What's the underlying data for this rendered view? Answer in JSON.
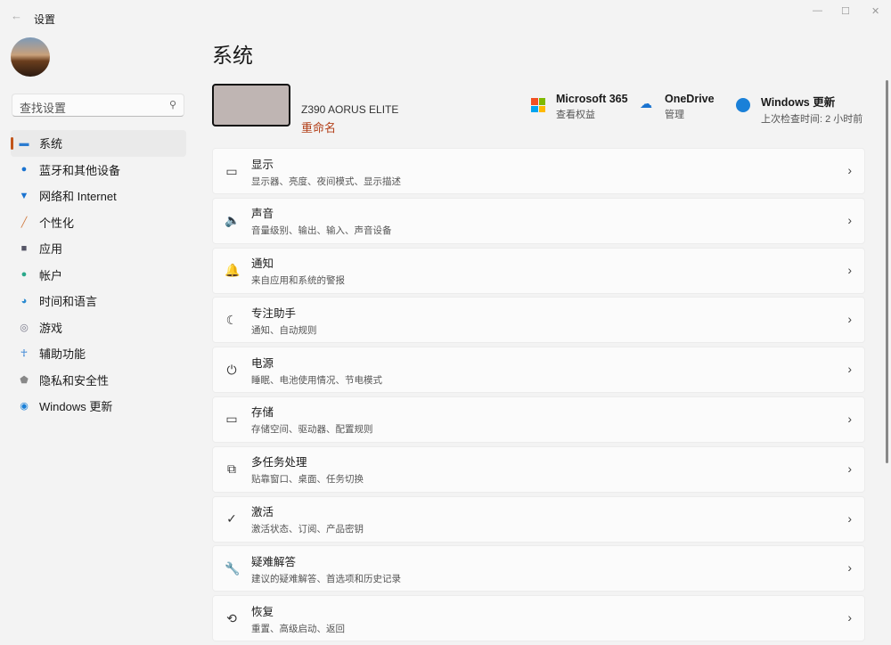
{
  "window": {
    "title": "设置",
    "back": "←"
  },
  "search": {
    "placeholder": "查找设置"
  },
  "nav": [
    {
      "label": "系统",
      "icon": "monitor-icon",
      "color": "#2a7bd0",
      "glyph": "▬"
    },
    {
      "label": "蓝牙和其他设备",
      "icon": "bluetooth-icon",
      "color": "#1a73d0",
      "glyph": "●"
    },
    {
      "label": "网络和 Internet",
      "icon": "wifi-icon",
      "color": "#1a73d0",
      "glyph": "▼"
    },
    {
      "label": "个性化",
      "icon": "brush-icon",
      "color": "#d07a40",
      "glyph": "╱"
    },
    {
      "label": "应用",
      "icon": "apps-icon",
      "color": "#556",
      "glyph": "■"
    },
    {
      "label": "帐户",
      "icon": "account-icon",
      "color": "#2aa88a",
      "glyph": "●"
    },
    {
      "label": "时间和语言",
      "icon": "globe-clock-icon",
      "color": "#2a8ad0",
      "glyph": "◕"
    },
    {
      "label": "游戏",
      "icon": "gamepad-icon",
      "color": "#778",
      "glyph": "◎"
    },
    {
      "label": "辅助功能",
      "icon": "accessibility-icon",
      "color": "#1a73d0",
      "glyph": "☥"
    },
    {
      "label": "隐私和安全性",
      "icon": "shield-icon",
      "color": "#888",
      "glyph": "⬟"
    },
    {
      "label": "Windows 更新",
      "icon": "update-icon",
      "color": "#1a80d8",
      "glyph": "◉"
    }
  ],
  "main": {
    "title": "系统",
    "device_name": "Z390 AORUS ELITE",
    "rename": "重命名",
    "services": [
      {
        "title": "Microsoft 365",
        "sub": "查看权益"
      },
      {
        "title": "OneDrive",
        "sub": "管理"
      },
      {
        "title": "Windows 更新",
        "sub": "上次检查时间: 2 小时前"
      }
    ],
    "items": [
      {
        "title": "显示",
        "sub": "显示器、亮度、夜间模式、显示描述",
        "icon": "display-icon",
        "glyph": "▭"
      },
      {
        "title": "声音",
        "sub": "音量级别、输出、输入、声音设备",
        "icon": "speaker-icon",
        "glyph": "🔈"
      },
      {
        "title": "通知",
        "sub": "来自应用和系统的警报",
        "icon": "bell-icon",
        "glyph": "🔔"
      },
      {
        "title": "专注助手",
        "sub": "通知、自动规则",
        "icon": "moon-icon",
        "glyph": "☾"
      },
      {
        "title": "电源",
        "sub": "睡眠、电池使用情况、节电模式",
        "icon": "power-icon",
        "glyph": "⏻"
      },
      {
        "title": "存储",
        "sub": "存储空间、驱动器、配置规则",
        "icon": "storage-icon",
        "glyph": "▭"
      },
      {
        "title": "多任务处理",
        "sub": "贴靠窗口、桌面、任务切换",
        "icon": "multitask-icon",
        "glyph": "⧉"
      },
      {
        "title": "激活",
        "sub": "激活状态、订阅、产品密钥",
        "icon": "check-circle-icon",
        "glyph": "✓"
      },
      {
        "title": "疑难解答",
        "sub": "建议的疑难解答、首选项和历史记录",
        "icon": "wrench-icon",
        "glyph": "🔧"
      },
      {
        "title": "恢复",
        "sub": "重置、高级启动、返回",
        "icon": "recovery-icon",
        "glyph": "⟲"
      }
    ]
  }
}
